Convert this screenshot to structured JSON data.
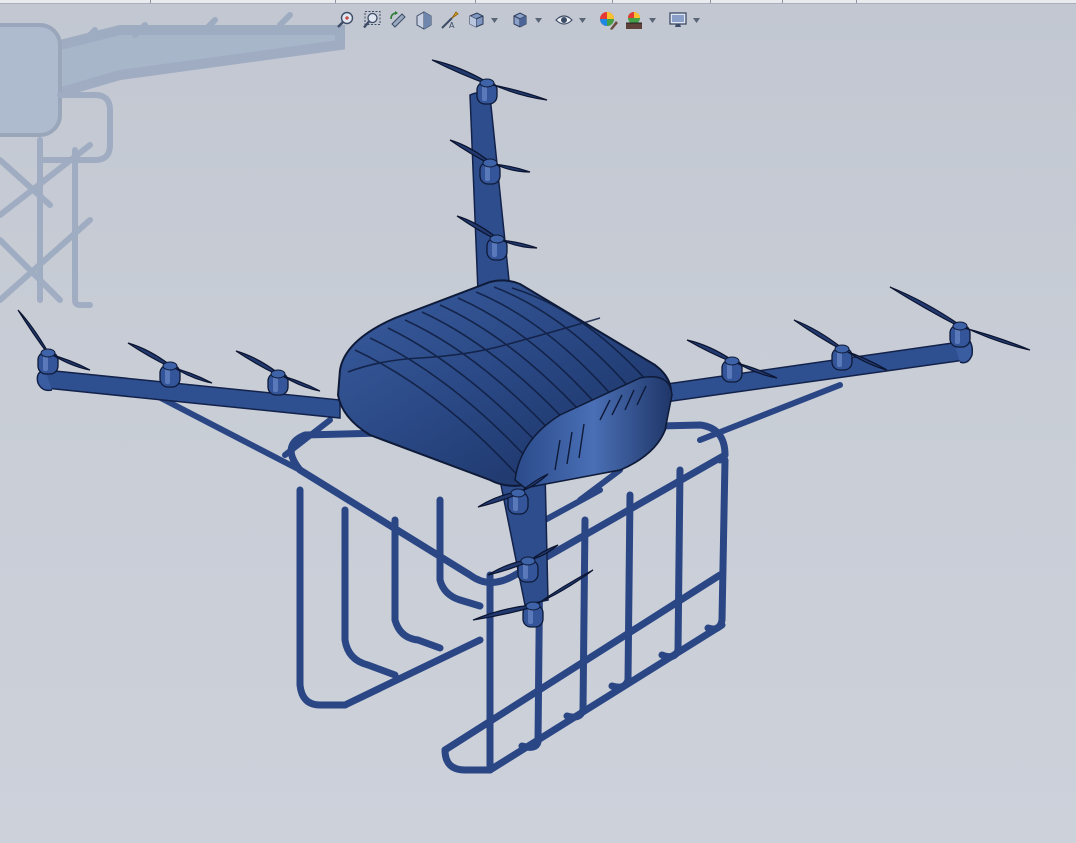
{
  "window": {
    "type": "cad-graphics-viewport"
  },
  "toolbar": {
    "buttons": [
      {
        "icon": "zoom-to-fit-icon"
      },
      {
        "icon": "zoom-to-area-icon"
      },
      {
        "icon": "previous-view-icon"
      },
      {
        "icon": "section-view-icon"
      },
      {
        "icon": "dynamic-annotation-view-icon"
      },
      {
        "icon": "view-orientation-icon",
        "dropdown": true
      },
      {
        "icon": "display-style-icon",
        "dropdown": true
      },
      {
        "icon": "hide-show-items-icon",
        "dropdown": true
      },
      {
        "icon": "edit-appearance-icon"
      },
      {
        "icon": "apply-scene-icon",
        "dropdown": true
      },
      {
        "icon": "view-settings-icon",
        "dropdown": true
      }
    ]
  },
  "colors": {
    "model": "#2f4e8e",
    "model_dark": "#16264d",
    "model_edge": "#0e1a38",
    "background": "#c6cbd5",
    "shadow": "#8d9cb4"
  }
}
